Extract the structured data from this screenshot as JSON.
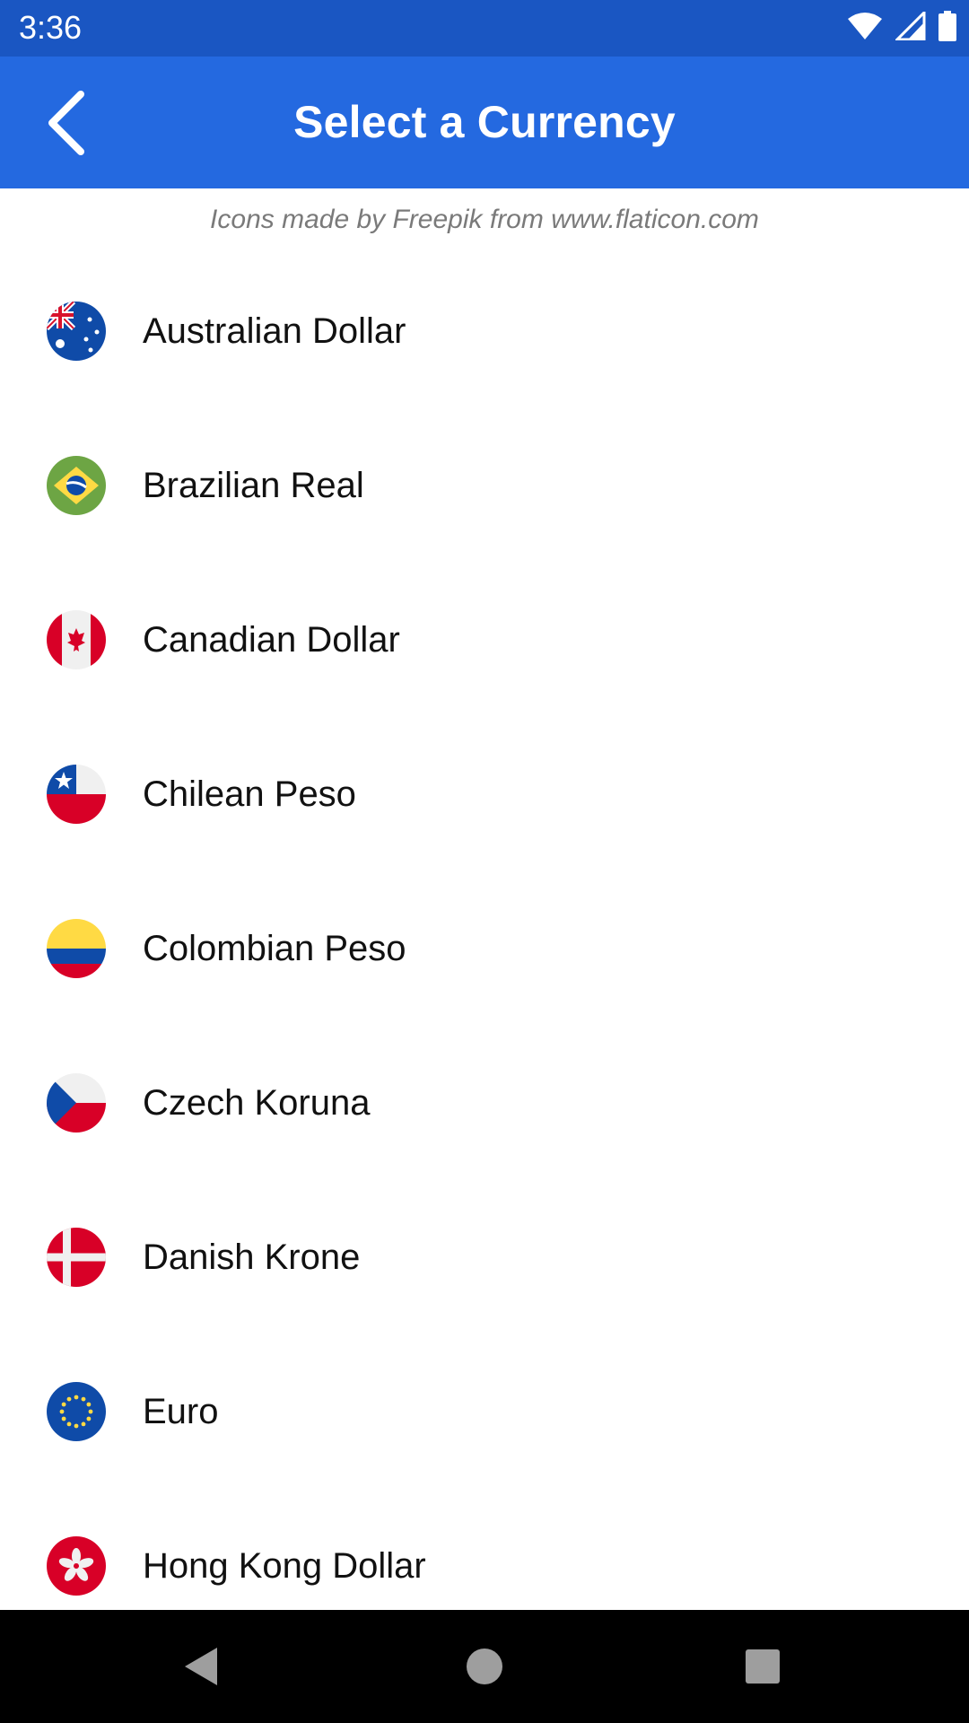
{
  "status_bar": {
    "time": "3:36",
    "icons": [
      "wifi-icon",
      "signal-icon",
      "battery-icon"
    ]
  },
  "app_bar": {
    "title": "Select a Currency",
    "back_icon": "back-chevron-icon"
  },
  "credit": "Icons made by Freepik from www.flaticon.com",
  "currencies": [
    {
      "label": "Australian Dollar",
      "icon": "australia-flag-icon"
    },
    {
      "label": "Brazilian Real",
      "icon": "brazil-flag-icon"
    },
    {
      "label": "Canadian Dollar",
      "icon": "canada-flag-icon"
    },
    {
      "label": "Chilean Peso",
      "icon": "chile-flag-icon"
    },
    {
      "label": "Colombian Peso",
      "icon": "colombia-flag-icon"
    },
    {
      "label": "Czech Koruna",
      "icon": "czech-flag-icon"
    },
    {
      "label": "Danish Krone",
      "icon": "denmark-flag-icon"
    },
    {
      "label": "Euro",
      "icon": "eu-flag-icon"
    },
    {
      "label": "Hong Kong Dollar",
      "icon": "hong-kong-flag-icon"
    }
  ],
  "nav_bar": {
    "icons": [
      "nav-back-icon",
      "nav-home-icon",
      "nav-recents-icon"
    ]
  },
  "colors": {
    "status_bar": "#1a56c2",
    "app_bar": "#2469e0",
    "credit_text": "#7a7a7a"
  }
}
